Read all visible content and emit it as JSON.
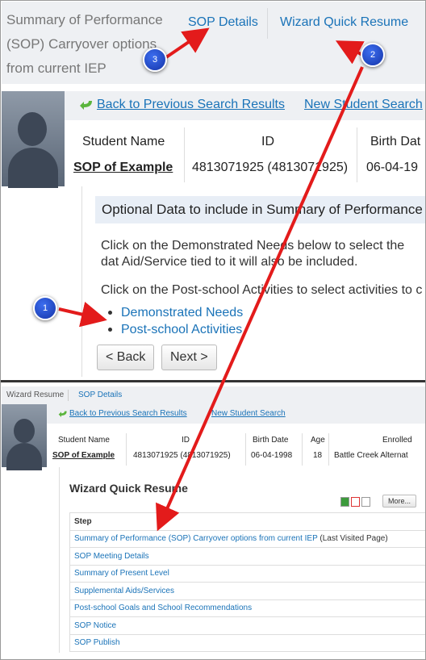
{
  "top": {
    "crumb_left": "Summary of Performance (SOP) Carryover options from current IEP",
    "sop_details": "SOP Details",
    "wizard_quick_resume": "Wizard Quick Resume",
    "back_link": "Back to Previous Search Results",
    "new_search": "New Student Search",
    "headers": {
      "name": "Student Name",
      "id": "ID",
      "birth": "Birth Dat"
    },
    "values": {
      "name": "SOP of Example",
      "id": "4813071925 (4813071925)",
      "birth": "06-04-19"
    },
    "optional": {
      "title": "Optional Data to include in Summary of Performance",
      "p1": "Click on the Demonstrated Needs below to select the dat Aid/Service tied to it will also be included.",
      "p2": "Click on the Post-school Activities to select activities to c",
      "items": [
        "Demonstrated Needs",
        "Post-school Activities"
      ],
      "back_btn": "< Back",
      "next_btn": "Next >"
    }
  },
  "bottom": {
    "bar_left": "Wizard Resume",
    "bar_sop": "SOP Details",
    "back_link": "Back to Previous Search Results",
    "new_search": "New Student Search",
    "headers": {
      "name": "Student Name",
      "id": "ID",
      "birth": "Birth Date",
      "age": "Age",
      "enrolled": "Enrolled"
    },
    "values": {
      "name": "SOP of Example",
      "id": "4813071925 (4813071925)",
      "birth": "06-04-1998",
      "age": "18",
      "enrolled": "Battle Creek Alternat"
    },
    "wqr_title": "Wizard Quick Resume",
    "more_btn": "More...",
    "step_header": "Step",
    "steps": [
      "Summary of Performance (SOP) Carryover options from current IEP",
      "SOP Meeting Details",
      "Summary of Present Level",
      "Supplemental Aids/Services",
      "Post-school Goals and School Recommendations",
      "SOP Notice",
      "SOP Publish"
    ],
    "last_visited": "(Last Visited Page)"
  },
  "badges": {
    "b1": "1",
    "b2": "2",
    "b3": "3"
  },
  "colors": {
    "link": "#1a73b8",
    "arrow": "#e31b1b",
    "badge": "#2a55d6"
  },
  "icons": [
    "back-arrow-icon",
    "excel-icon",
    "pdf-icon",
    "doc-icon",
    "avatar-silhouette"
  ]
}
